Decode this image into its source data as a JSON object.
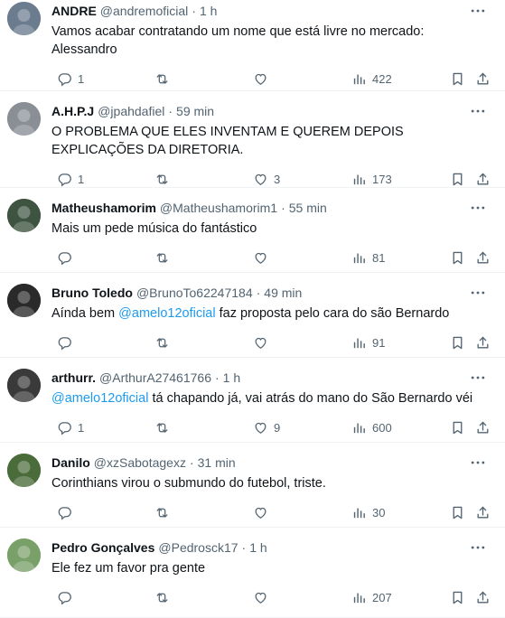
{
  "tweets": [
    {
      "name": "ANDRE",
      "handle": "@andremoficial",
      "time": "1 h",
      "text_parts": [
        "Vamos acabar contratando um nome que está livre no mercado: Alessandro"
      ],
      "replies": "1",
      "retweets": "",
      "likes": "",
      "views": "422",
      "avatar_color": "#6b7c8f"
    },
    {
      "name": "A.H.P.J",
      "handle": "@jpahdafiel",
      "time": "59 min",
      "text_parts": [
        "O PROBLEMA QUE ELES INVENTAM E QUEREM DEPOIS EXPLICAÇÕES DA DIRETORIA."
      ],
      "replies": "1",
      "retweets": "",
      "likes": "3",
      "views": "173",
      "avatar_color": "#8a8f96"
    },
    {
      "name": "Matheushamorim",
      "handle": "@Matheushamorim1",
      "time": "55 min",
      "text_parts": [
        "Mais um pede música do fantástico"
      ],
      "replies": "",
      "retweets": "",
      "likes": "",
      "views": "81",
      "avatar_color": "#3e5440"
    },
    {
      "name": "Bruno Toledo",
      "handle": "@BrunoTo62247184",
      "time": "49 min",
      "text_parts": [
        "Aínda bem ",
        "@amelo12oficial",
        " faz proposta pelo cara do são Bernardo"
      ],
      "replies": "",
      "retweets": "",
      "likes": "",
      "views": "91",
      "avatar_color": "#2a2a2a"
    },
    {
      "name": "arthurr.",
      "handle": "@ArthurA27461766",
      "time": "1 h",
      "text_parts": [
        "",
        "@amelo12oficial",
        " tá chapando já, vai atrás do mano do São Bernardo véi"
      ],
      "replies": "1",
      "retweets": "",
      "likes": "9",
      "views": "600",
      "avatar_color": "#3a3a3a"
    },
    {
      "name": "Danilo",
      "handle": "@xzSabotagexz",
      "time": "31 min",
      "text_parts": [
        "Corinthians virou o submundo do futebol, triste."
      ],
      "replies": "",
      "retweets": "",
      "likes": "",
      "views": "30",
      "avatar_color": "#4a6b3a"
    },
    {
      "name": "Pedro Gonçalves",
      "handle": "@Pedrosck17",
      "time": "1 h",
      "text_parts": [
        "Ele fez um favor pra gente"
      ],
      "replies": "",
      "retweets": "",
      "likes": "",
      "views": "207",
      "avatar_color": "#7aa06a"
    }
  ],
  "icons": {
    "reply": "reply-icon",
    "retweet": "retweet-icon",
    "like": "heart-icon",
    "views": "views-icon",
    "bookmark": "bookmark-icon",
    "share": "share-icon",
    "more": "more-icon"
  }
}
